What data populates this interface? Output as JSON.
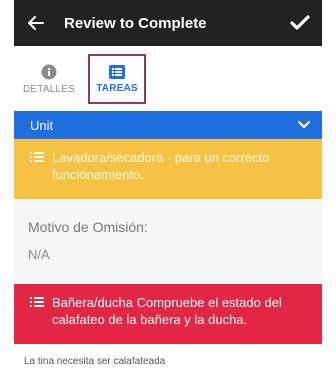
{
  "header": {
    "title": "Review to Complete"
  },
  "tabs": [
    {
      "label": "DETALLES",
      "icon": "info-icon"
    },
    {
      "label": "TAREAS",
      "icon": "task-list-icon"
    }
  ],
  "unit": {
    "label": "Unit"
  },
  "tasks": [
    {
      "text": "Lavadora/secadora - para un correcto funcionamiento.",
      "color": "#f5c243"
    },
    {
      "text": "Bañera/ducha Compruebe el estado del calafateo de la bañera y la ducha.",
      "color": "#e32643"
    }
  ],
  "omission": {
    "label": "Motivo de Omisión:",
    "value": "N/A"
  },
  "note": "La tina necesita ser calafateada",
  "colors": {
    "accent": "#1f6fe0",
    "appbar": "#222222",
    "tab_highlight": "#8b3a6d"
  }
}
